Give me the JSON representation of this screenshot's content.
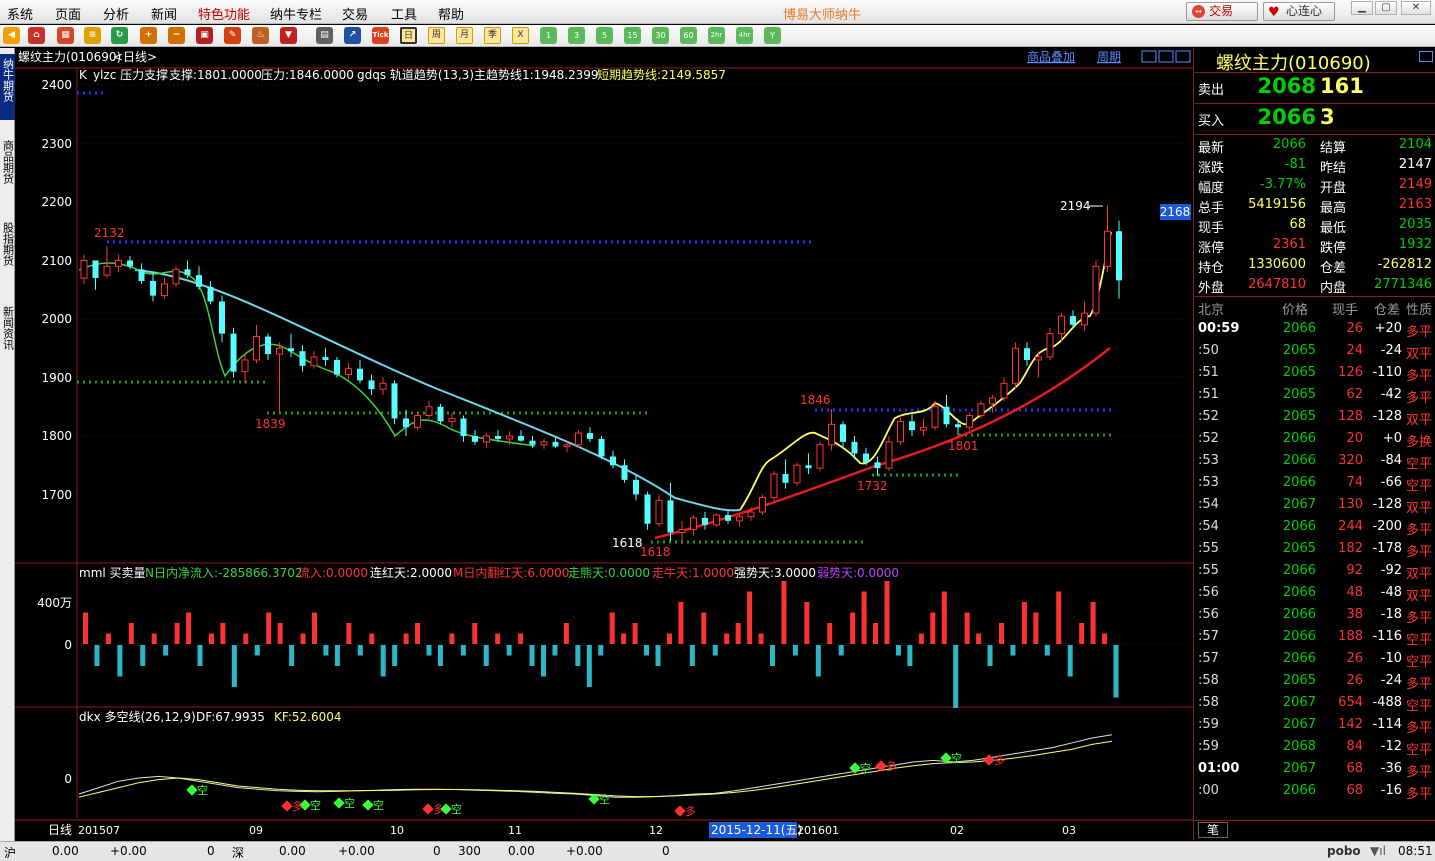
{
  "menu": {
    "items": [
      "系统",
      "页面",
      "分析",
      "新闻",
      "特色功能",
      "纳牛专栏",
      "交易",
      "工具",
      "帮助"
    ],
    "active": "特色功能",
    "app_title": "博易大师纳牛",
    "trade_button": "交易",
    "connect_button": "心连心"
  },
  "toolbar": {
    "icons": [
      "back-icon",
      "home-icon",
      "calendar-icon",
      "refresh-icon",
      "zoom-in-icon",
      "zoom-out-icon",
      "window-icon",
      "draw-pen-icon",
      "stamp-icon",
      "filter-icon",
      "table-icon",
      "chart-line-icon",
      "tick-icon",
      "period-day-icon",
      "period-week-icon",
      "period-month-icon",
      "period-quarter-icon",
      "period-multi-icon",
      "min1-icon",
      "min3-icon",
      "min5-icon",
      "min15-icon",
      "min30-icon",
      "min60-icon",
      "hour2-icon",
      "hour4-icon",
      "year-icon"
    ],
    "tick_label": "Tick",
    "period_labels": [
      "日",
      "周",
      "月",
      "季",
      "X"
    ],
    "minute_labels": [
      "1",
      "3",
      "5",
      "15",
      "30",
      "60",
      "2hr",
      "4hr",
      "Y"
    ]
  },
  "sidebar": {
    "tabs": [
      "纳牛期货",
      "商品期货",
      "股指期货",
      "新闻资讯"
    ]
  },
  "chart": {
    "instrument_title": "螺纹主力(010690)",
    "period_label": "<日线>",
    "overlay_button": "商品叠加",
    "period_button": "周期",
    "main_indicator": {
      "prefix": "K",
      "ylzc": "ylzc 压力支撑",
      "support": "支撑:1801.0000",
      "resistance": "压力:1846.0000",
      "gdqs": "gdqs 轨道趋势(13,3)",
      "main_trend": "主趋势线1:1948.2399",
      "short_trend": "短期趋势线:2149.5857"
    },
    "y_axis": [
      "2400",
      "2300",
      "2200",
      "2100",
      "2000",
      "1900",
      "1800",
      "1700"
    ],
    "annotations": {
      "high_2132": "2132",
      "low_1839": "1839",
      "low_1618a": "1618",
      "low_1618b": "1618",
      "high_1846": "1846",
      "low_1732": "1732",
      "low_1801": "1801",
      "high_2194": "2194",
      "last_price_tag": "2168"
    },
    "volume_indicator": {
      "name": "mml 买卖量",
      "net_inflow": "N日内净流入:-285866.3702",
      "inflow": "流入:0.0000",
      "lianhong": "连红天:2.0000",
      "fanhong": "M日内翻红天:6.0000",
      "zouxiong": "走熊天:0.0000",
      "zouniu": "走牛天:1.0000",
      "qiang": "强势天:3.0000",
      "ruo": "弱势天:0.0000",
      "axis_top": "400万",
      "axis_zero": "0"
    },
    "dkx_indicator": {
      "name": "dkx 多空线(26,12,9)",
      "df": "DF:67.9935",
      "kf": "KF:52.6004",
      "axis_zero": "0",
      "signal_short": "空",
      "signal_long": "多"
    },
    "x_axis": {
      "period": "日线",
      "labels": [
        "201507",
        "09",
        "10",
        "11",
        "12",
        "201601",
        "02",
        "03"
      ],
      "cursor_date": "2015-12-11(五)"
    },
    "colors": {
      "up": "#ff3232",
      "down": "#54ffff",
      "ma_fast": "#ffff66",
      "ma_mid": "#6fd8e8",
      "ma_slow": "#e81c1c",
      "resistance": "#2b2bff",
      "support": "#1e9a1e"
    },
    "candles": [
      [
        1,
        2070,
        2110,
        2060,
        2100
      ],
      [
        2,
        2100,
        2095,
        2050,
        2070
      ],
      [
        3,
        2075,
        2125,
        2070,
        2090
      ],
      [
        4,
        2090,
        2110,
        2080,
        2100
      ],
      [
        5,
        2100,
        2108,
        2085,
        2090
      ],
      [
        6,
        2085,
        2095,
        2060,
        2065
      ],
      [
        7,
        2065,
        2080,
        2030,
        2040
      ],
      [
        8,
        2040,
        2070,
        2035,
        2060
      ],
      [
        9,
        2060,
        2090,
        2055,
        2085
      ],
      [
        10,
        2085,
        2100,
        2070,
        2075
      ],
      [
        11,
        2075,
        2090,
        2050,
        2055
      ],
      [
        12,
        2055,
        2065,
        2025,
        2030
      ],
      [
        13,
        2030,
        2040,
        1960,
        1975
      ],
      [
        14,
        1975,
        1985,
        1900,
        1910
      ],
      [
        15,
        1910,
        1940,
        1890,
        1930
      ],
      [
        16,
        1930,
        1990,
        1925,
        1970
      ],
      [
        17,
        1970,
        1975,
        1930,
        1940
      ],
      [
        18,
        1940,
        1960,
        1839,
        1950
      ],
      [
        19,
        1950,
        1975,
        1935,
        1945
      ],
      [
        20,
        1945,
        1955,
        1910,
        1920
      ],
      [
        21,
        1920,
        1945,
        1915,
        1935
      ],
      [
        22,
        1935,
        1950,
        1920,
        1930
      ],
      [
        23,
        1930,
        1935,
        1900,
        1905
      ],
      [
        24,
        1905,
        1925,
        1895,
        1915
      ],
      [
        25,
        1915,
        1930,
        1890,
        1895
      ],
      [
        26,
        1895,
        1905,
        1870,
        1880
      ],
      [
        27,
        1880,
        1900,
        1870,
        1890
      ],
      [
        28,
        1890,
        1895,
        1820,
        1830
      ],
      [
        29,
        1830,
        1845,
        1800,
        1815
      ],
      [
        30,
        1815,
        1840,
        1810,
        1835
      ],
      [
        31,
        1835,
        1860,
        1830,
        1850
      ],
      [
        32,
        1850,
        1855,
        1820,
        1825
      ],
      [
        33,
        1825,
        1840,
        1815,
        1830
      ],
      [
        34,
        1830,
        1835,
        1790,
        1800
      ],
      [
        35,
        1800,
        1810,
        1785,
        1790
      ],
      [
        36,
        1790,
        1805,
        1780,
        1800
      ],
      [
        37,
        1800,
        1810,
        1790,
        1795
      ],
      [
        38,
        1795,
        1808,
        1785,
        1800
      ],
      [
        39,
        1800,
        1810,
        1790,
        1792
      ],
      [
        40,
        1792,
        1800,
        1780,
        1785
      ],
      [
        41,
        1785,
        1795,
        1778,
        1790
      ],
      [
        42,
        1790,
        1800,
        1780,
        1782
      ],
      [
        43,
        1782,
        1790,
        1772,
        1785
      ],
      [
        44,
        1785,
        1810,
        1780,
        1805
      ],
      [
        45,
        1805,
        1815,
        1790,
        1795
      ],
      [
        46,
        1795,
        1800,
        1760,
        1765
      ],
      [
        47,
        1765,
        1775,
        1745,
        1750
      ],
      [
        48,
        1750,
        1760,
        1720,
        1725
      ],
      [
        49,
        1725,
        1735,
        1690,
        1700
      ],
      [
        50,
        1700,
        1705,
        1640,
        1650
      ],
      [
        51,
        1650,
        1700,
        1645,
        1690
      ],
      [
        52,
        1690,
        1720,
        1620,
        1635
      ],
      [
        53,
        1635,
        1655,
        1618,
        1640
      ],
      [
        54,
        1640,
        1665,
        1630,
        1660
      ],
      [
        55,
        1660,
        1670,
        1640,
        1648
      ],
      [
        56,
        1648,
        1668,
        1645,
        1665
      ],
      [
        57,
        1665,
        1672,
        1650,
        1655
      ],
      [
        58,
        1655,
        1665,
        1645,
        1662
      ],
      [
        59,
        1662,
        1678,
        1655,
        1670
      ],
      [
        60,
        1670,
        1700,
        1665,
        1695
      ],
      [
        61,
        1695,
        1740,
        1690,
        1735
      ],
      [
        62,
        1735,
        1760,
        1710,
        1720
      ],
      [
        63,
        1720,
        1755,
        1715,
        1750
      ],
      [
        64,
        1750,
        1770,
        1735,
        1745
      ],
      [
        65,
        1745,
        1790,
        1740,
        1785
      ],
      [
        66,
        1785,
        1846,
        1775,
        1820
      ],
      [
        67,
        1820,
        1825,
        1780,
        1790
      ],
      [
        68,
        1790,
        1800,
        1760,
        1770
      ],
      [
        69,
        1770,
        1780,
        1750,
        1755
      ],
      [
        70,
        1755,
        1765,
        1732,
        1745
      ],
      [
        71,
        1745,
        1800,
        1740,
        1790
      ],
      [
        72,
        1790,
        1835,
        1785,
        1825
      ],
      [
        73,
        1825,
        1840,
        1800,
        1810
      ],
      [
        74,
        1810,
        1830,
        1800,
        1815
      ],
      [
        75,
        1815,
        1860,
        1810,
        1850
      ],
      [
        76,
        1850,
        1870,
        1815,
        1820
      ],
      [
        77,
        1820,
        1830,
        1801,
        1815
      ],
      [
        78,
        1815,
        1840,
        1810,
        1835
      ],
      [
        79,
        1835,
        1860,
        1830,
        1855
      ],
      [
        80,
        1855,
        1870,
        1840,
        1865
      ],
      [
        81,
        1865,
        1900,
        1860,
        1890
      ],
      [
        82,
        1890,
        1960,
        1880,
        1950
      ],
      [
        83,
        1950,
        1960,
        1920,
        1930
      ],
      [
        84,
        1930,
        1945,
        1900,
        1935
      ],
      [
        85,
        1935,
        1985,
        1930,
        1975
      ],
      [
        86,
        1975,
        2010,
        1960,
        2005
      ],
      [
        87,
        2005,
        2015,
        1985,
        1990
      ],
      [
        88,
        1990,
        2030,
        1980,
        2010
      ],
      [
        89,
        2010,
        2100,
        2005,
        2090
      ],
      [
        90,
        2090,
        2194,
        2080,
        2150
      ],
      [
        91,
        2150,
        2168,
        2035,
        2066
      ]
    ],
    "volume_bars": [
      3,
      -2,
      1,
      -3,
      2,
      -2,
      1,
      -1,
      2,
      3,
      -2,
      1,
      2,
      -4,
      1,
      -1,
      3,
      2,
      -2,
      1,
      3,
      -1,
      -2,
      2,
      -1,
      1,
      -3,
      -2,
      1,
      2,
      -1,
      -2,
      1,
      -1,
      2,
      -2,
      1,
      -1,
      1,
      -2,
      -3,
      -1,
      2,
      -2,
      -4,
      -1,
      3,
      1,
      2,
      -1,
      -2,
      1,
      4,
      -2,
      3,
      -1,
      1,
      2,
      5,
      1,
      -2,
      6,
      -1,
      4,
      -3,
      2,
      -1,
      3,
      5,
      2,
      6,
      -1,
      -2,
      1,
      3,
      5,
      -6,
      3,
      1,
      -2,
      2,
      -1,
      4,
      3,
      -1,
      5,
      -3,
      2,
      4,
      1,
      -5
    ],
    "dkx_line": [
      -0.5,
      -0.3,
      -0.1,
      0,
      0.05,
      0,
      -0.1,
      -0.2,
      -0.3,
      -0.35,
      -0.4,
      -0.42,
      -0.43,
      -0.42,
      -0.4,
      -0.38,
      -0.36,
      -0.35,
      -0.35,
      -0.36,
      -0.38,
      -0.4,
      -0.42,
      -0.45,
      -0.48,
      -0.5,
      -0.55,
      -0.6,
      -0.6,
      -0.58,
      -0.55,
      -0.5,
      -0.48,
      -0.4,
      -0.3,
      -0.2,
      -0.1,
      0,
      0.1,
      0.2,
      0.3,
      0.4,
      0.5,
      0.55,
      0.5,
      0.55,
      0.65,
      0.75,
      0.85,
      0.95,
      1.1,
      1.25,
      1.35
    ],
    "kf_line": [
      -0.6,
      -0.45,
      -0.3,
      -0.15,
      -0.05,
      0,
      -0.05,
      -0.15,
      -0.25,
      -0.3,
      -0.35,
      -0.38,
      -0.4,
      -0.4,
      -0.4,
      -0.39,
      -0.38,
      -0.37,
      -0.36,
      -0.36,
      -0.37,
      -0.38,
      -0.4,
      -0.42,
      -0.45,
      -0.48,
      -0.52,
      -0.56,
      -0.58,
      -0.58,
      -0.56,
      -0.53,
      -0.5,
      -0.45,
      -0.38,
      -0.3,
      -0.2,
      -0.1,
      0,
      0.1,
      0.2,
      0.3,
      0.38,
      0.45,
      0.48,
      0.5,
      0.55,
      0.62,
      0.7,
      0.8,
      0.9,
      1.05,
      1.15
    ]
  },
  "quote": {
    "title": "螺纹主力(010690)",
    "sell_label": "卖出",
    "sell_price": "2068",
    "sell_vol": "161",
    "buy_label": "买入",
    "buy_price": "2066",
    "buy_vol": "3",
    "rows": [
      {
        "l1": "最新",
        "v1": "2066",
        "c1": "#00d000",
        "l2": "结算",
        "v2": "2104",
        "c2": "#00d000"
      },
      {
        "l1": "涨跌",
        "v1": "-81",
        "c1": "#00d000",
        "l2": "昨结",
        "v2": "2147",
        "c2": "#ffffff"
      },
      {
        "l1": "幅度",
        "v1": "-3.77%",
        "c1": "#00d000",
        "l2": "开盘",
        "v2": "2149",
        "c2": "#ff3232"
      },
      {
        "l1": "总手",
        "v1": "5419156",
        "c1": "#ffff66",
        "l2": "最高",
        "v2": "2163",
        "c2": "#ff3232"
      },
      {
        "l1": "现手",
        "v1": "68",
        "c1": "#ffff66",
        "l2": "最低",
        "v2": "2035",
        "c2": "#00d000"
      },
      {
        "l1": "涨停",
        "v1": "2361",
        "c1": "#ff3232",
        "l2": "跌停",
        "v2": "1932",
        "c2": "#00d000"
      },
      {
        "l1": "持仓",
        "v1": "1330600",
        "c1": "#ffff66",
        "l2": "仓差",
        "v2": "-262812",
        "c2": "#ffff66"
      },
      {
        "l1": "外盘",
        "v1": "2647810",
        "c1": "#ff3232",
        "l2": "内盘",
        "v2": "2771346",
        "c2": "#00d000"
      }
    ],
    "tick_header": {
      "time": "北京",
      "price": "价格",
      "vol": "现手",
      "oi": "仓差",
      "type": "性质"
    },
    "ticks": [
      {
        "t": "00:59",
        "p": "2066",
        "v": "26",
        "oi": "+20",
        "ty": "多平",
        "tc": "#ff3232"
      },
      {
        "t": ":50",
        "p": "2065",
        "v": "24",
        "oi": "-24",
        "ty": "双平",
        "tc": "#ff3232"
      },
      {
        "t": ":51",
        "p": "2065",
        "v": "126",
        "oi": "-110",
        "ty": "多平",
        "tc": "#ff3232"
      },
      {
        "t": ":51",
        "p": "2065",
        "v": "62",
        "oi": "-42",
        "ty": "多平",
        "tc": "#ff3232"
      },
      {
        "t": ":52",
        "p": "2065",
        "v": "128",
        "oi": "-128",
        "ty": "双平",
        "tc": "#ff3232"
      },
      {
        "t": ":52",
        "p": "2066",
        "v": "20",
        "oi": "+0",
        "ty": "多换",
        "tc": "#ff3232"
      },
      {
        "t": ":53",
        "p": "2066",
        "v": "320",
        "oi": "-84",
        "ty": "空平",
        "tc": "#ff3232"
      },
      {
        "t": ":53",
        "p": "2066",
        "v": "74",
        "oi": "-66",
        "ty": "空平",
        "tc": "#ff3232"
      },
      {
        "t": ":54",
        "p": "2067",
        "v": "130",
        "oi": "-128",
        "ty": "双平",
        "tc": "#ff3232"
      },
      {
        "t": ":54",
        "p": "2066",
        "v": "244",
        "oi": "-200",
        "ty": "多平",
        "tc": "#ff3232"
      },
      {
        "t": ":55",
        "p": "2065",
        "v": "182",
        "oi": "-178",
        "ty": "多平",
        "tc": "#ff3232"
      },
      {
        "t": ":55",
        "p": "2066",
        "v": "92",
        "oi": "-92",
        "ty": "双平",
        "tc": "#ff3232"
      },
      {
        "t": ":56",
        "p": "2066",
        "v": "48",
        "oi": "-48",
        "ty": "双平",
        "tc": "#ff3232"
      },
      {
        "t": ":56",
        "p": "2066",
        "v": "38",
        "oi": "-18",
        "ty": "多平",
        "tc": "#ff3232"
      },
      {
        "t": ":57",
        "p": "2066",
        "v": "188",
        "oi": "-116",
        "ty": "空平",
        "tc": "#ff3232"
      },
      {
        "t": ":57",
        "p": "2066",
        "v": "26",
        "oi": "-10",
        "ty": "空平",
        "tc": "#ff3232"
      },
      {
        "t": ":58",
        "p": "2065",
        "v": "26",
        "oi": "-24",
        "ty": "多平",
        "tc": "#ff3232"
      },
      {
        "t": ":58",
        "p": "2067",
        "v": "654",
        "oi": "-488",
        "ty": "空平",
        "tc": "#ff3232"
      },
      {
        "t": ":59",
        "p": "2067",
        "v": "142",
        "oi": "-114",
        "ty": "多平",
        "tc": "#ff3232"
      },
      {
        "t": ":59",
        "p": "2068",
        "v": "84",
        "oi": "-12",
        "ty": "空平",
        "tc": "#ff3232"
      },
      {
        "t": "01:00",
        "p": "2067",
        "v": "68",
        "oi": "-36",
        "ty": "多平",
        "tc": "#ff3232"
      },
      {
        "t": ":00",
        "p": "2066",
        "v": "68",
        "oi": "-16",
        "ty": "多平",
        "tc": "#ff3232"
      }
    ],
    "bottom_tab": "笔"
  },
  "status": {
    "sh_label": "沪",
    "sh_val1": "0.00",
    "sh_val2": "+0.00",
    "sh_val3": "0",
    "sz_label": "深",
    "sz_val1": "0.00",
    "sz_val2": "+0.00",
    "sz_val3": "0",
    "sz_val4": "300",
    "sz_val5": "0.00",
    "sz_val6": "+0.00",
    "sz_val7": "0",
    "brand": "pobo",
    "time": "08:51"
  }
}
